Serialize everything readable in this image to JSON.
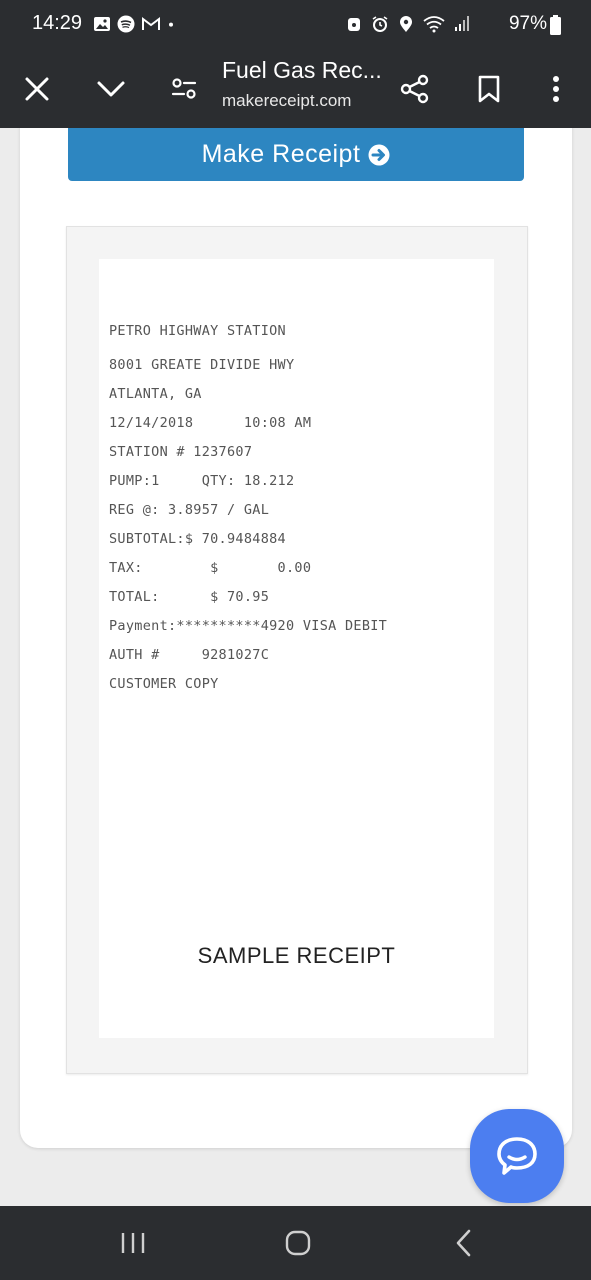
{
  "status_bar": {
    "time": "14:29",
    "battery": "97%",
    "left_icons": [
      "gallery-icon",
      "spotify-icon",
      "gmail-icon",
      "dot-icon"
    ],
    "right_icons": [
      "lock-icon",
      "alarm-icon",
      "location-icon",
      "wifi-icon",
      "signal-icon",
      "battery-icon"
    ]
  },
  "toolbar": {
    "title": "Fuel Gas Rec...",
    "url": "makereceipt.com",
    "icons": [
      "close-icon",
      "chevron-down-icon",
      "page-settings-icon",
      "share-icon",
      "bookmark-icon",
      "more-icon"
    ]
  },
  "main": {
    "make_button_label": "Make Receipt",
    "receipt": {
      "lines": [
        "PETRO HIGHWAY STATION",
        "8001 GREATE DIVIDE HWY",
        "ATLANTA, GA",
        "12/14/2018      10:08 AM",
        "STATION # 1237607",
        "PUMP:1     QTY: 18.212",
        "REG @: 3.8957 / GAL",
        "SUBTOTAL:$ 70.9484884",
        "TAX:        $       0.00",
        "TOTAL:      $ 70.95",
        "Payment:**********4920 VISA DEBIT",
        "AUTH #     9281027C",
        "CUSTOMER COPY"
      ],
      "watermark": "SAMPLE RECEIPT"
    }
  },
  "chat": {
    "icon": "chat-bubble-icon"
  },
  "nav_bar": {
    "icons": [
      "recent-apps-icon",
      "home-icon",
      "back-icon"
    ]
  },
  "colors": {
    "bars": "#2b2d30",
    "button": "#2d86c1",
    "chat": "#4c7ef0"
  }
}
